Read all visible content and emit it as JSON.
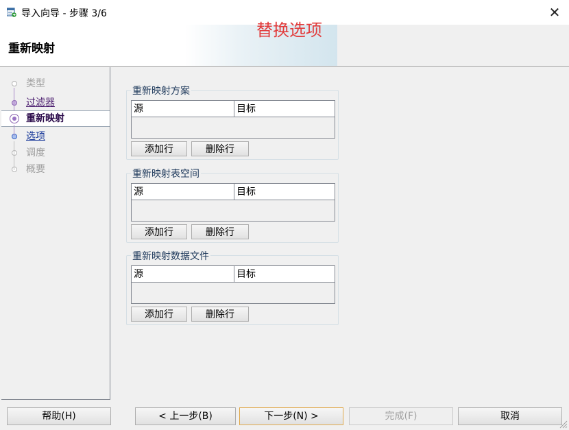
{
  "window": {
    "title": "导入向导 - 步骤 3/6",
    "close_symbol": "✕"
  },
  "header": {
    "step_title": "重新映射",
    "annotation": "替换选项"
  },
  "nav": {
    "items": [
      {
        "label": "类型",
        "state": "disabled"
      },
      {
        "label": "过滤器",
        "state": "visited"
      },
      {
        "label": "重新映射",
        "state": "current"
      },
      {
        "label": "选项",
        "state": "link"
      },
      {
        "label": "调度",
        "state": "disabled"
      },
      {
        "label": "概要",
        "state": "disabled"
      }
    ]
  },
  "groups": [
    {
      "title": "重新映射方案",
      "columns": [
        "源",
        "目标"
      ],
      "add_label": "添加行",
      "delete_label": "删除行"
    },
    {
      "title": "重新映射表空间",
      "columns": [
        "源",
        "目标"
      ],
      "add_label": "添加行",
      "delete_label": "删除行"
    },
    {
      "title": "重新映射数据文件",
      "columns": [
        "源",
        "目标"
      ],
      "add_label": "添加行",
      "delete_label": "删除行"
    }
  ],
  "footer": {
    "help": "帮助(H)",
    "back": "< 上一步(B)",
    "next": "下一步(N) >",
    "finish": "完成(F)",
    "cancel": "取消"
  },
  "icons": {
    "app": "import-wizard-icon",
    "close": "close-icon",
    "grip": "resize-grip-icon"
  },
  "colors": {
    "annotation": "#e23b3b",
    "group_title": "#1e395b",
    "focus_border": "#e0a84a"
  }
}
